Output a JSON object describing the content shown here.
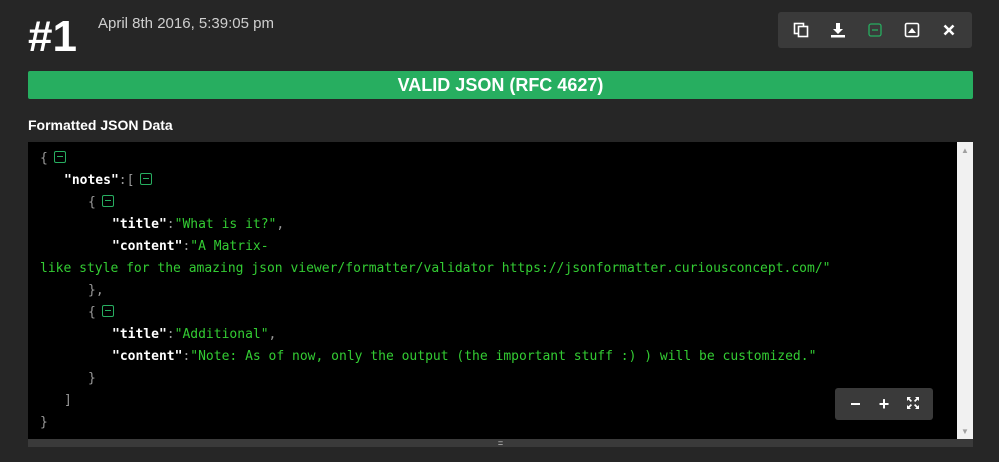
{
  "header": {
    "entry_number": "#1",
    "timestamp": "April 8th 2016, 5:39:05 pm"
  },
  "toolbar": {
    "buttons": [
      {
        "name": "copy",
        "icon": "copy-icon"
      },
      {
        "name": "download",
        "icon": "download-icon"
      },
      {
        "name": "collapse",
        "icon": "collapse-all-icon"
      },
      {
        "name": "expand",
        "icon": "expand-icon"
      },
      {
        "name": "close",
        "icon": "close-icon"
      }
    ]
  },
  "status": {
    "label": "VALID JSON (RFC 4627)",
    "color": "#27ae60"
  },
  "section": {
    "title": "Formatted JSON Data"
  },
  "json_view": {
    "lines": {
      "l1_open": "{",
      "l2_key": "\"notes\"",
      "l2_punct": ":[",
      "l3_open": "{",
      "l4_key": "\"title\"",
      "l4_punct": ":",
      "l4_value": "\"What is it?\"",
      "l4_comma": ",",
      "l5_key": "\"content\"",
      "l5_punct": ":",
      "l5_value": "\"A Matrix-",
      "l6_value": "like style for the amazing json viewer/formatter/validator https://jsonformatter.curiousconcept.com/\"",
      "l7_close": "},",
      "l8_open": "{",
      "l9_key": "\"title\"",
      "l9_punct": ":",
      "l9_value": "\"Additional\"",
      "l9_comma": ",",
      "l10_key": "\"content\"",
      "l10_punct": ":",
      "l10_value": "\"Note: As of now, only the output (the important stuff :) ) will be customized.\"",
      "l11_close": "}",
      "l12_close": "]",
      "l13_close": "}"
    },
    "colors": {
      "background": "#000000",
      "key": "#ffffff",
      "string": "#33cc33",
      "punctuation": "#9a9a9a"
    }
  },
  "zoom": {
    "minus": "−",
    "plus": "+",
    "fullscreen_icon": "fullscreen-icon"
  },
  "resize_handle": "="
}
